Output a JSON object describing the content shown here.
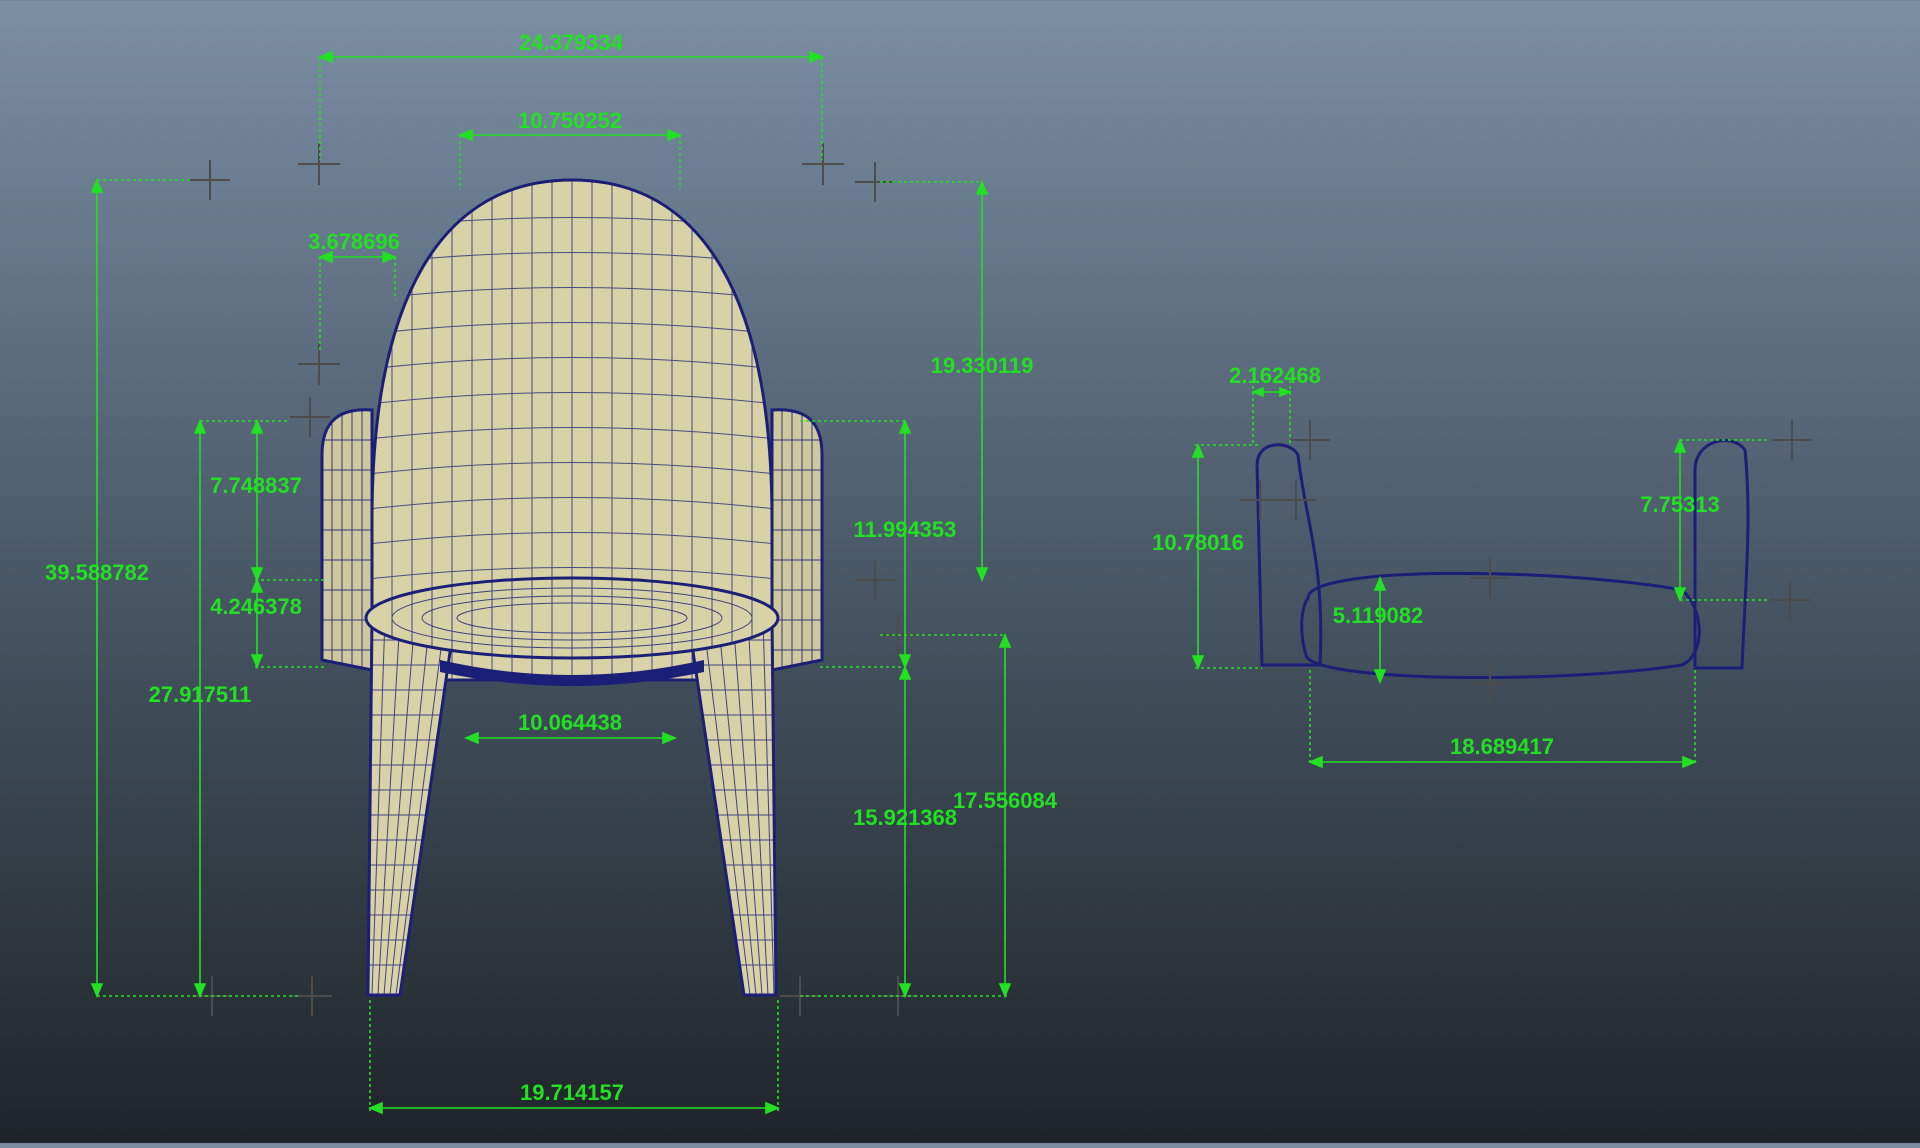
{
  "colors": {
    "dimension": "#22e022",
    "wire": "#1b1f78",
    "surface": "#d8d2a6",
    "locator": "#4a4a4a"
  },
  "dimensions": {
    "back_total_width": "24.379334",
    "back_top_width": "10.750252",
    "arm_width": "3.678696",
    "total_height": "39.588782",
    "arm_height": "27.917511",
    "arm_upper": "7.748837",
    "arm_lower": "4.246378",
    "back_height": "19.330119",
    "arm_to_seat": "11.994353",
    "seat_height": "15.921368",
    "seat_top_height": "17.556084",
    "leg_inner_width": "10.064438",
    "base_width": "19.714157",
    "side_arm_width": "2.162468",
    "side_arm_height": "10.78016",
    "side_arm_right": "7.75313",
    "side_cushion_height": "5.119082",
    "side_cushion_width": "18.689417"
  }
}
